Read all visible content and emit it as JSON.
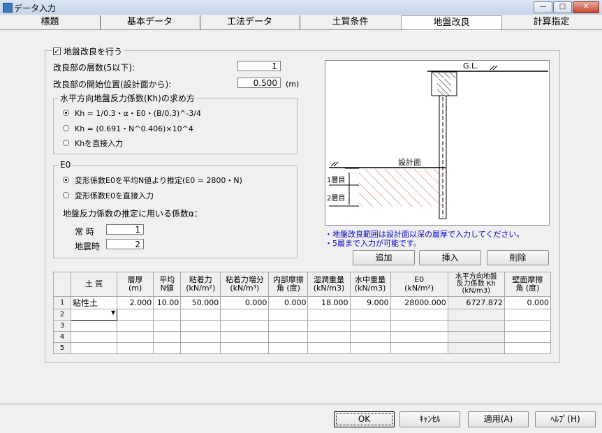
{
  "window": {
    "title": "データ入力",
    "minimize": "—",
    "maximize": "□",
    "close": "✕"
  },
  "tabs": [
    "標題",
    "基本データ",
    "工法データ",
    "土質条件",
    "地盤改良",
    "計算指定"
  ],
  "active_tab": "地盤改良",
  "improvement": {
    "enable_label": "地盤改良を行う",
    "enabled": true,
    "layers_label": "改良部の層数(5以下):",
    "layers_value": "1",
    "start_label": "改良部の開始位置(設計面から):",
    "start_value": "0.500",
    "start_unit": "(m)"
  },
  "kh_group": {
    "title": "水平方向地盤反力係数(Kh)の求め方",
    "options": [
      "Kh = 1/0.3・α・E0・(B/0.3)^-3/4",
      "Kh = (0.691・N^0.406)×10^4",
      "Khを直接入力"
    ],
    "selected_index": 0
  },
  "e0_group": {
    "title": "E0",
    "options": [
      "変形係数E0を平均N値より推定(E0 = 2800・N)",
      "変形係数E0を直接入力"
    ],
    "selected_index": 0,
    "alpha_label": "地盤反力係数の推定に用いる係数α：",
    "normal_label": "常 時",
    "normal_value": "1",
    "seismic_label": "地震時",
    "seismic_value": "2"
  },
  "diagram": {
    "gl_label": "G.L.",
    "design_surface_label": "設計面",
    "layer1_label": "1層目",
    "layer2_label": "2層目"
  },
  "notes": [
    "・地盤改良範囲は設計面以深の層厚で入力してください。",
    "・5層まで入力が可能です。"
  ],
  "buttons": {
    "add": "追加",
    "insert": "挿入",
    "delete": "削除",
    "ok": "OK",
    "cancel": "ｷｬﾝｾﾙ",
    "apply": "適用(A)",
    "help": "ﾍﾙﾌﾟ(H)"
  },
  "table": {
    "headers": [
      "土 質",
      "層厚\n(m)",
      "平均\nN値",
      "粘着力\n(kN/m²)",
      "粘着力増分\n(kN/m³)",
      "内部摩擦\n角 (度)",
      "湿潤重量\n(kN/m3)",
      "水中重量\n(kN/m3)",
      "E0\n(kN/m²)",
      "水平方向地盤\n反力係数 Kh\n(kN/m3)",
      "壁面摩擦\n角 (度)"
    ],
    "row_numbers": [
      "1",
      "2",
      "3",
      "4",
      "5"
    ],
    "rows": [
      [
        "粘性土",
        "2.000",
        "10.00",
        "50.000",
        "0.000",
        "0.000",
        "18.000",
        "9.000",
        "28000.000",
        "6727.872",
        "0.000"
      ]
    ]
  },
  "colors": {
    "hatch": "#e06060",
    "note_text": "#0000cc"
  }
}
